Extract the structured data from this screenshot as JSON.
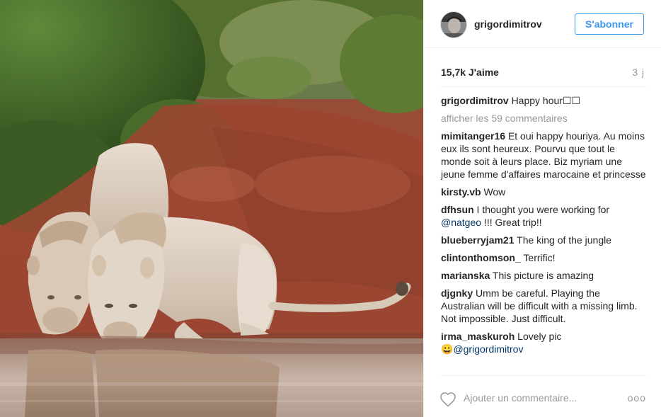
{
  "post": {
    "photo_alt": "photo",
    "header": {
      "username": "grigordimitrov",
      "follow_label": "S'abonner"
    },
    "likes": "15,7k J'aime",
    "age": "3 j",
    "caption": {
      "user": "grigordimitrov",
      "text": "Happy hour☐☐"
    },
    "view_all_comments": "afficher les 59 commentaires",
    "comments": [
      {
        "user": "mimitanger16",
        "text": "Et oui happy houriya. Au moins eux ils sont heureux. Pourvu que tout le monde soit à leurs place. Biz myriam une jeune femme d'affaires marocaine et princesse"
      },
      {
        "user": "kirsty.vb",
        "text": "Wow"
      },
      {
        "user": "dfhsun",
        "text_before": "I thought you were working for ",
        "mention": "@natgeo",
        "text_after": " !!! Great trip!!"
      },
      {
        "user": "blueberryjam21",
        "text": "The king of the jungle"
      },
      {
        "user": "clintonthomson_",
        "text": "Terrific!"
      },
      {
        "user": "marianska",
        "text": "This picture is amazing"
      },
      {
        "user": "djgnky",
        "text": "Umm be careful. Playing the Australian will be difficult with a missing limb. Not impossible. Just difficult."
      },
      {
        "user": "irma_maskuroh",
        "text": "Lovely pic",
        "emoji": "😀",
        "mention": "@grigordimitrov"
      }
    ],
    "footer": {
      "add_comment_placeholder": "Ajouter un commentaire...",
      "more_options": "ooo"
    }
  }
}
